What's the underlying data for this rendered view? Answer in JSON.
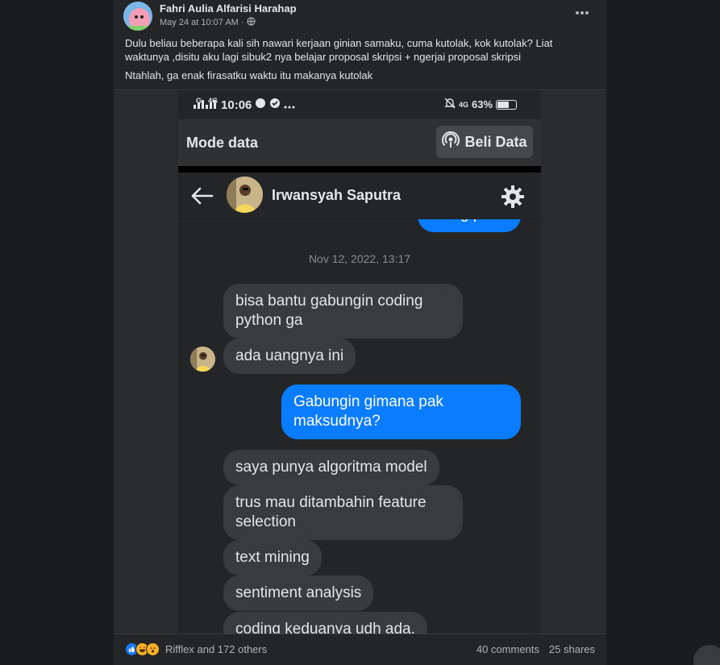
{
  "post": {
    "author": "Fahri Aulia Alfarisi Harahap",
    "date": "May 24 at 10:07 AM",
    "separator": "·",
    "privacy_icon": "globe-icon",
    "more_icon": "more-dots-icon",
    "caption_line1": "Dulu beliau beberapa kali sih nawari kerjaan ginian samaku, cuma kutolak, kok kutolak? Liat waktunya ,disitu aku lagi sibuk2 nya belajar proposal skripsi + ngerjai proposal skripsi",
    "caption_line2": "Ntahlah, ga enak firasatku waktu itu makanya kutolak"
  },
  "phone": {
    "status": {
      "signal_label": "G",
      "network_label": "4G",
      "time": "10:06",
      "right_network": "4G",
      "battery": "63%",
      "battery_level": 0.63
    },
    "mode_bar": {
      "title": "Mode data",
      "button_label": "Beli Data",
      "button_icon": "broadcast-icon"
    },
    "chat": {
      "name": "Irwansyah Saputra",
      "back_icon": "back-arrow-icon",
      "settings_icon": "gear-icon",
      "partial_out": "Siang pack",
      "timestamp": "Nov 12, 2022, 13:17",
      "messages": [
        {
          "dir": "in",
          "text": "bisa bantu gabungin coding python ga"
        },
        {
          "dir": "in",
          "text": "ada uangnya ini"
        },
        {
          "dir": "out",
          "text": "Gabungin gimana pak maksudnya?"
        },
        {
          "dir": "in",
          "text": "saya punya algoritma model"
        },
        {
          "dir": "in",
          "text": "trus mau ditambahin feature selection"
        },
        {
          "dir": "in",
          "text": "text mining"
        },
        {
          "dir": "in",
          "text": "sentiment analysis"
        },
        {
          "dir": "in",
          "text": "coding keduanya udh ada."
        }
      ]
    }
  },
  "footer": {
    "reactions_text": "Rifflex and 172 others",
    "comments": "40 comments",
    "shares": "25 shares",
    "reaction_icons": [
      "like-icon",
      "haha-icon",
      "wow-icon"
    ]
  }
}
